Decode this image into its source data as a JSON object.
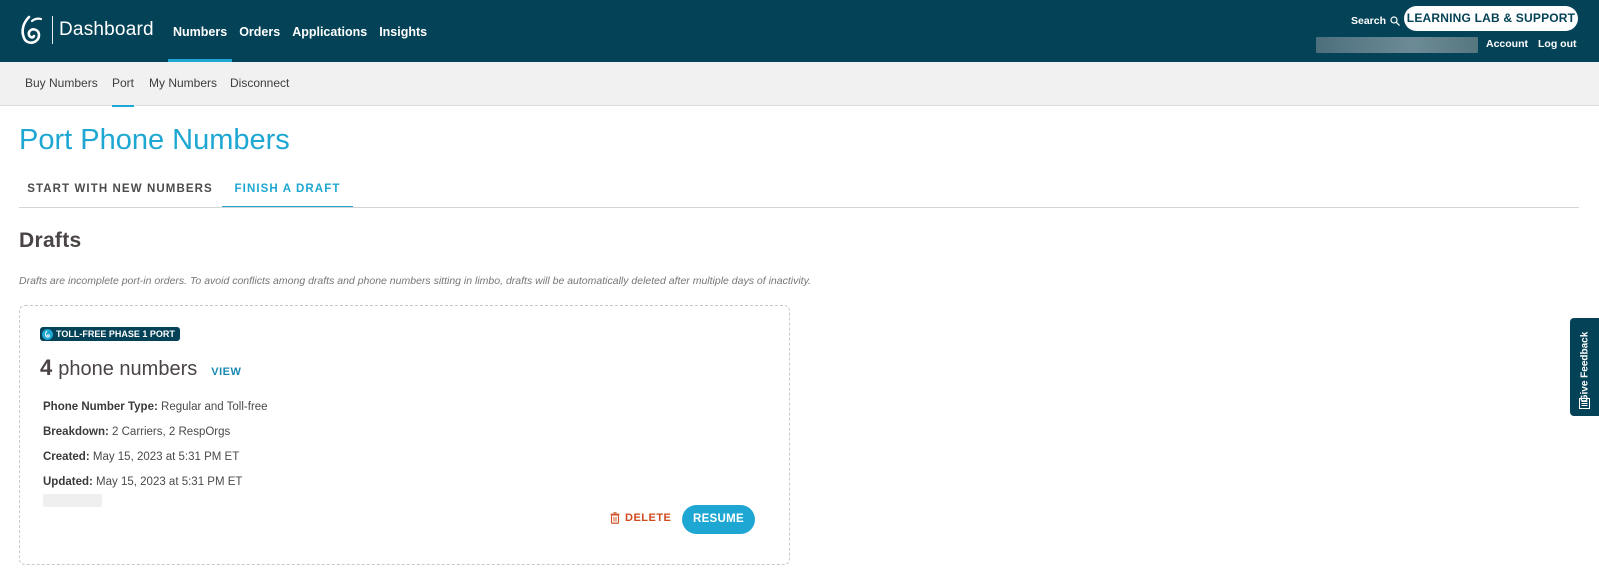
{
  "header": {
    "brand": "Dashboard",
    "nav": [
      {
        "label": "Numbers",
        "active": true
      },
      {
        "label": "Orders",
        "active": false
      },
      {
        "label": "Applications",
        "active": false
      },
      {
        "label": "Insights",
        "active": false
      }
    ],
    "search_label": "Search",
    "support_button": "LEARNING LAB & SUPPORT",
    "account_link": "Account",
    "logout_link": "Log out"
  },
  "subnav": [
    {
      "label": "Buy Numbers",
      "active": false
    },
    {
      "label": "Port",
      "active": true
    },
    {
      "label": "My Numbers",
      "active": false
    },
    {
      "label": "Disconnect",
      "active": false
    }
  ],
  "page": {
    "title": "Port Phone Numbers",
    "tabs": [
      {
        "label": "START WITH NEW NUMBERS",
        "active": false
      },
      {
        "label": "FINISH A DRAFT",
        "active": true
      }
    ],
    "section_title": "Drafts",
    "description": "Drafts are incomplete port-in orders. To avoid conflicts among drafts and phone numbers sitting in limbo, drafts will be automatically deleted after multiple days of inactivity."
  },
  "draft": {
    "badge": "TOLL-FREE PHASE 1 PORT",
    "count": "4",
    "count_label": "phone numbers",
    "view_link": "VIEW",
    "details": [
      {
        "label": "Phone Number Type:",
        "value": "Regular and Toll-free"
      },
      {
        "label": "Breakdown:",
        "value": "2 Carriers, 2 RespOrgs"
      },
      {
        "label": "Created:",
        "value": "May 15, 2023 at 5:31 PM ET"
      },
      {
        "label": "Updated:",
        "value": "May 15, 2023 at 5:31 PM ET"
      }
    ],
    "delete_button": "DELETE",
    "resume_button": "RESUME"
  },
  "feedback": {
    "label": "Give Feedback"
  },
  "colors": {
    "header_bg": "#044257",
    "accent": "#1ea7d2",
    "danger": "#d04a1f",
    "subnav_bg": "#f1f1f1"
  }
}
